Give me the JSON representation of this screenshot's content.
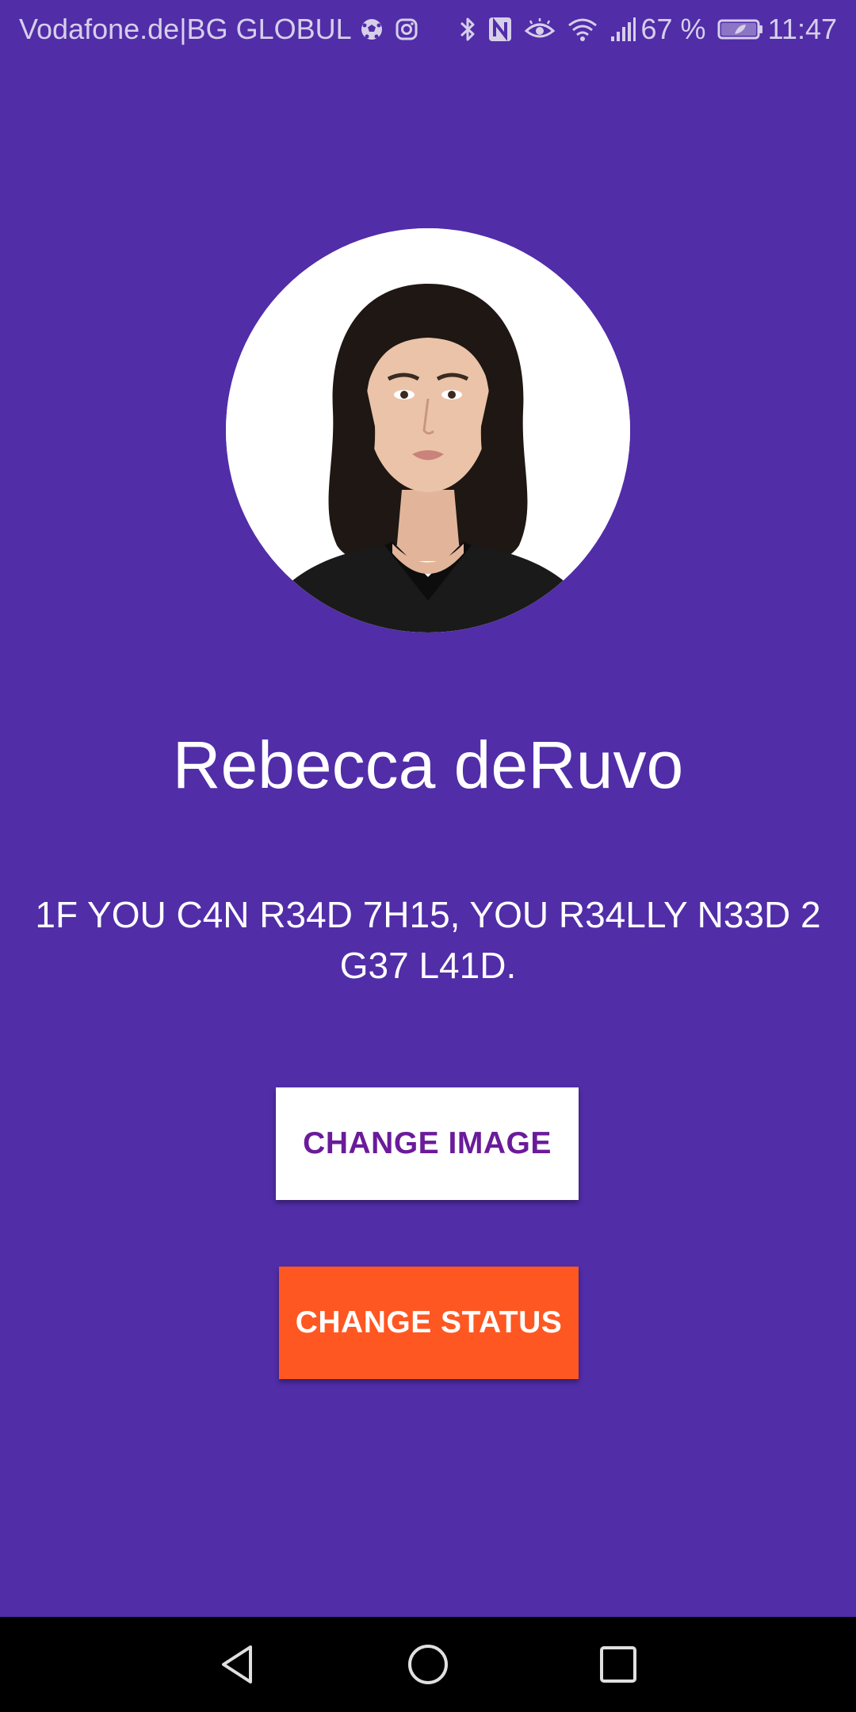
{
  "status_bar": {
    "carrier": "Vodafone.de|BG GLOBUL",
    "battery_percent": "67 %",
    "time": "11:47",
    "icons": [
      "soccer-ball-icon",
      "instagram-icon",
      "bluetooth-icon",
      "nfc-icon",
      "eye-comfort-icon",
      "wifi-icon",
      "signal-icon",
      "battery-icon"
    ]
  },
  "profile": {
    "name": "Rebecca deRuvo",
    "status_message": "1F YOU C4N R34D 7H15, YOU R34LLY N33D 2 G37 L41D.",
    "avatar": "profile-photo"
  },
  "buttons": {
    "change_image": "CHANGE IMAGE",
    "change_status": "CHANGE STATUS"
  },
  "nav_bar": {
    "icons": [
      "back-icon",
      "home-icon",
      "recents-icon"
    ]
  },
  "colors": {
    "background": "#512DA8",
    "change_image_bg": "#FFFFFF",
    "change_image_text": "#6A1B9A",
    "change_status_bg": "#FF5722",
    "change_status_text": "#FFFFFF",
    "nav_bar": "#000000"
  }
}
